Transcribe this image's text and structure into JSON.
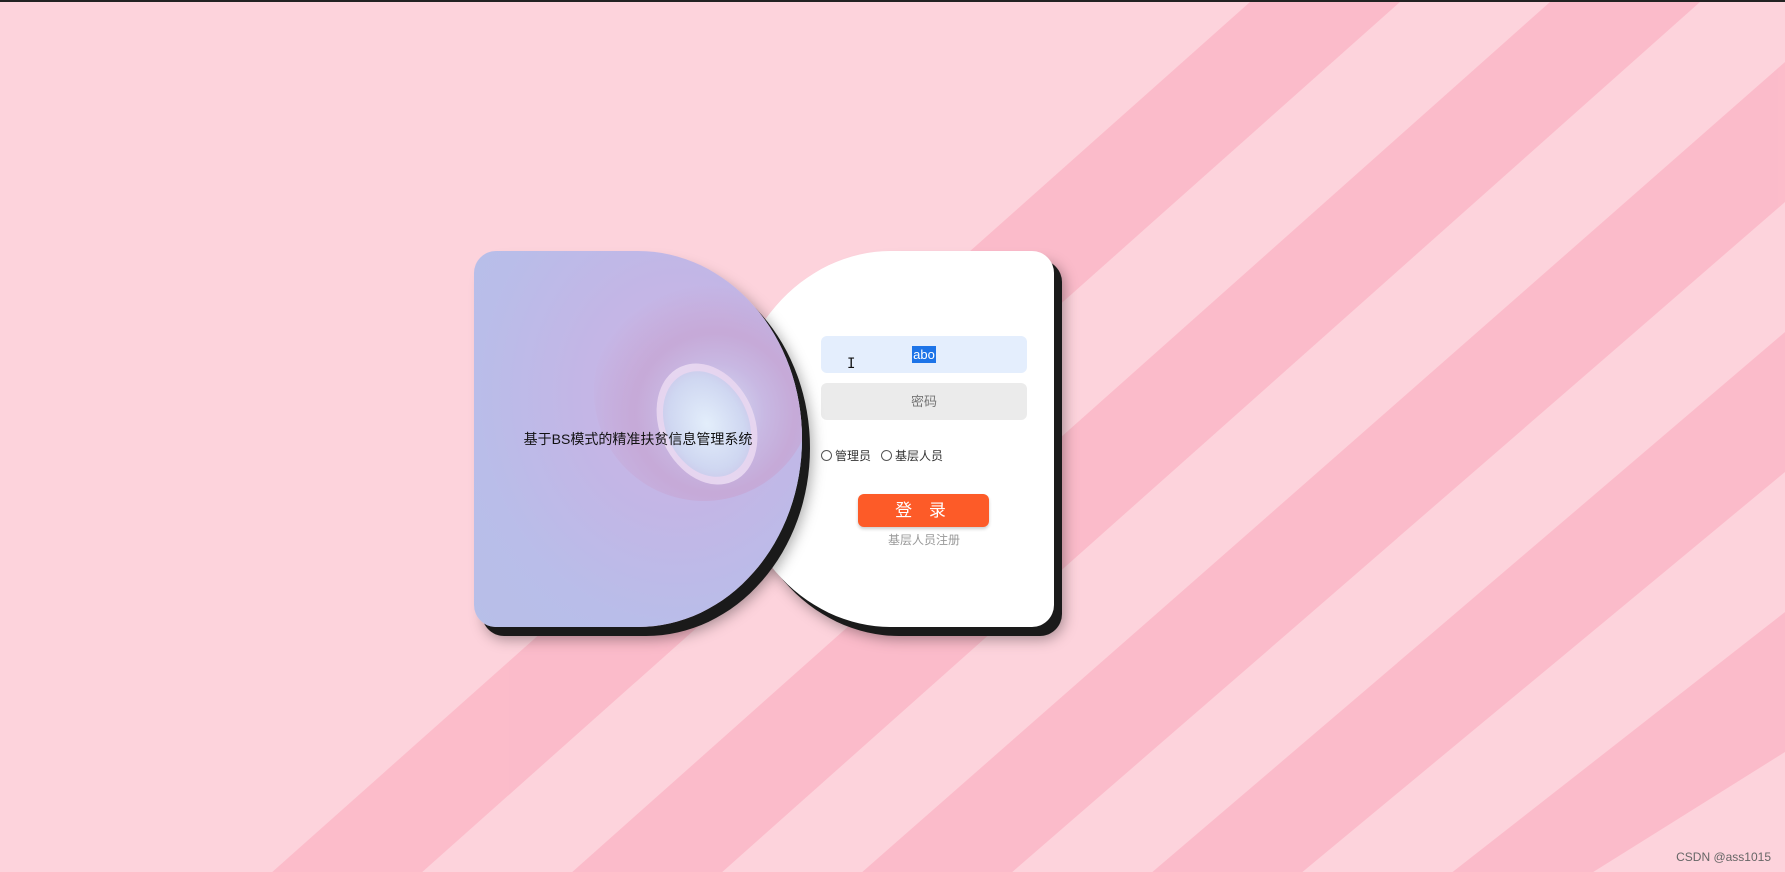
{
  "brand": {
    "system_title": "基于BS模式的精准扶贫信息管理系统"
  },
  "login_form": {
    "username_value": "abo",
    "password_placeholder": "密码",
    "roles": [
      {
        "label": "管理员",
        "selected": false
      },
      {
        "label": "基层人员",
        "selected": false
      }
    ],
    "login_label": "登 录",
    "register_label": "基层人员注册"
  },
  "watermark": "CSDN @ass1015",
  "colors": {
    "background": "#fdd3dc",
    "stripe": "#fbb2c2",
    "left_card": "#b9bde9",
    "lens": "#b9dcfd",
    "login_button": "#fd5b28",
    "username_field": "#e4eefd",
    "password_field": "#ebebeb"
  },
  "icons": {
    "text_cursor": "text-cursor-icon"
  }
}
